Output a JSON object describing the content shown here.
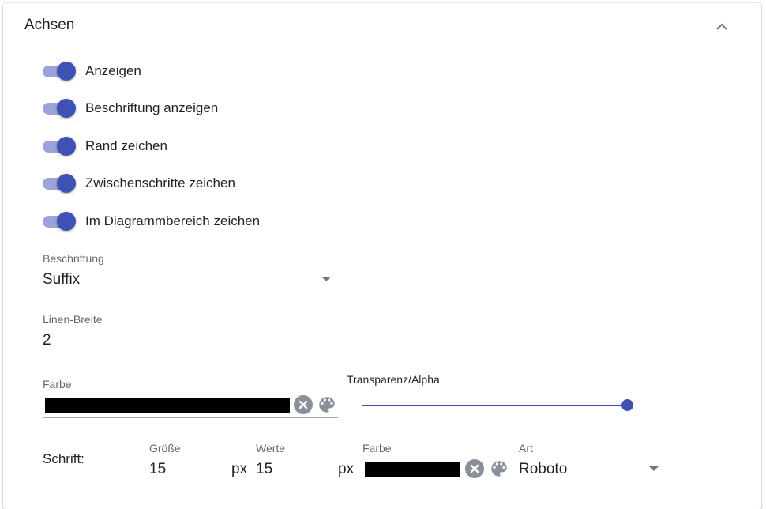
{
  "section": {
    "title": "Achsen",
    "collapse_icon": "chevron-up-icon"
  },
  "toggles": [
    {
      "label": "Anzeigen",
      "on": true
    },
    {
      "label": "Beschriftung anzeigen",
      "on": true
    },
    {
      "label": "Rand zeichen",
      "on": true
    },
    {
      "label": "Zwischenschritte zeichen",
      "on": true
    },
    {
      "label": "Im Diagrammbereich zeichen",
      "on": true
    }
  ],
  "beschriftung": {
    "label": "Beschriftung",
    "value": "Suffix"
  },
  "linien_breite": {
    "label": "Linen-Breite",
    "value": "2"
  },
  "farbe": {
    "label": "Farbe",
    "color": "#000000"
  },
  "transparenz": {
    "label": "Transparenz/Alpha",
    "value": 1.0
  },
  "schrift": {
    "label": "Schrift:",
    "groesse": {
      "label": "Größe",
      "value": "15",
      "unit": "px"
    },
    "werte": {
      "label": "Werte",
      "value": "15",
      "unit": "px"
    },
    "farbe": {
      "label": "Farbe",
      "color": "#000000"
    },
    "art": {
      "label": "Art",
      "value": "Roboto"
    }
  },
  "colors": {
    "accent": "#3f51b5",
    "track": "#9ba3da",
    "clear": "#8a9099",
    "palette": "#8a9099"
  }
}
